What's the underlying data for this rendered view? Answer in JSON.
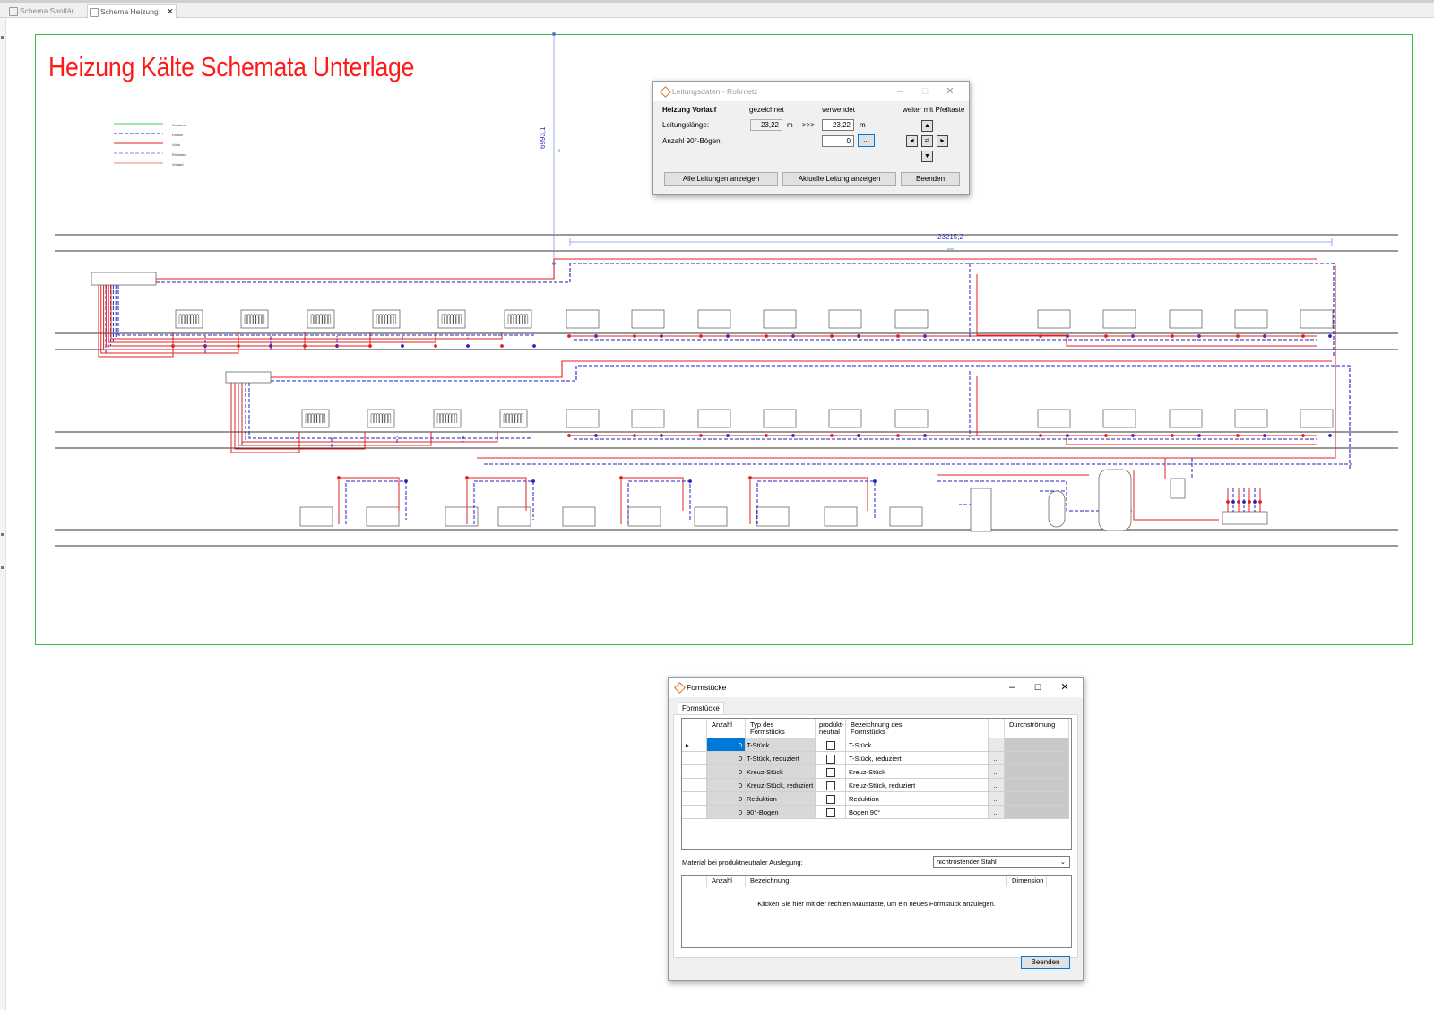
{
  "tabs": [
    {
      "label": "Schema Sanitär",
      "active": false
    },
    {
      "label": "Schema Heizung",
      "active": true
    }
  ],
  "tab_close_icon": "×",
  "drawing": {
    "title": "Heizung Kälte Schemata Unterlage",
    "title_color": "#ff1a1a",
    "legend": [
      "Kondens",
      "Rücklv",
      "Vorlo",
      "Rücklauf",
      "Vorlauf"
    ],
    "dimension_horizontal": "23215,2",
    "dimension_vertical": "6993,1",
    "colors": {
      "supply": "#e02020",
      "return": "#2020c0",
      "frame": "#3bbf3b",
      "dimension": "#5a7ad0"
    }
  },
  "leitungsdaten": {
    "title": "Leitungsdaten - Rohrnetz",
    "heading": "Heizung Vorlauf",
    "col_drawn": "gezeichnet",
    "col_used": "verwendet",
    "col_arrows": "weiter mit Pfeiltaste",
    "length_label": "Leitungslänge:",
    "length_drawn": "23,22",
    "length_unit": "m",
    "transfer": ">>>",
    "length_used": "23,22",
    "bends_label": "Anzahl 90°-Bögen:",
    "bends_value": "0",
    "browse": "...",
    "arrows": {
      "up": "▲",
      "left": "◄",
      "swap": "⇄",
      "right": "►",
      "down": "▼"
    },
    "buttons": {
      "show_all": "Alle Leitungen anzeigen",
      "show_current": "Aktuelle Leitung anzeigen",
      "close": "Beenden"
    },
    "window": {
      "minimize": "–",
      "maximize": "☐",
      "close": "✕"
    }
  },
  "formstuecke": {
    "title": "Formstücke",
    "tab": "Formstücke",
    "window": {
      "minimize": "–",
      "maximize": "☐",
      "close": "✕"
    },
    "grid_headers": [
      "Anzahl",
      "Typ des Formstücks",
      "produkt-neutral",
      "Bezeichnung des Formstücks",
      "Durchströmung"
    ],
    "row_indicator": "▸",
    "rows": [
      {
        "anzahl": "0",
        "typ": "T-Stück",
        "bezeichnung": "T-Stück"
      },
      {
        "anzahl": "0",
        "typ": "T-Stück, reduziert",
        "bezeichnung": "T-Stück, reduziert"
      },
      {
        "anzahl": "0",
        "typ": "Kreuz-Stück",
        "bezeichnung": "Kreuz-Stück"
      },
      {
        "anzahl": "0",
        "typ": "Kreuz-Stück, reduziert",
        "bezeichnung": "Kreuz-Stück, reduziert"
      },
      {
        "anzahl": "0",
        "typ": "Reduktion",
        "bezeichnung": "Reduktion"
      },
      {
        "anzahl": "0",
        "typ": "90°-Bogen",
        "bezeichnung": "Bogen 90°"
      }
    ],
    "row_button": "...",
    "material_label": "Material bei produktneutraler Auslegung:",
    "material_value": "nichtrostender Stahl",
    "grid2_headers": [
      "Anzahl",
      "Bezeichnung",
      "Dimension"
    ],
    "grid2_hint": "Klicken Sie hier mit der rechten Maustaste, um ein neues Formstück anzulegen.",
    "close_button": "Beenden"
  }
}
